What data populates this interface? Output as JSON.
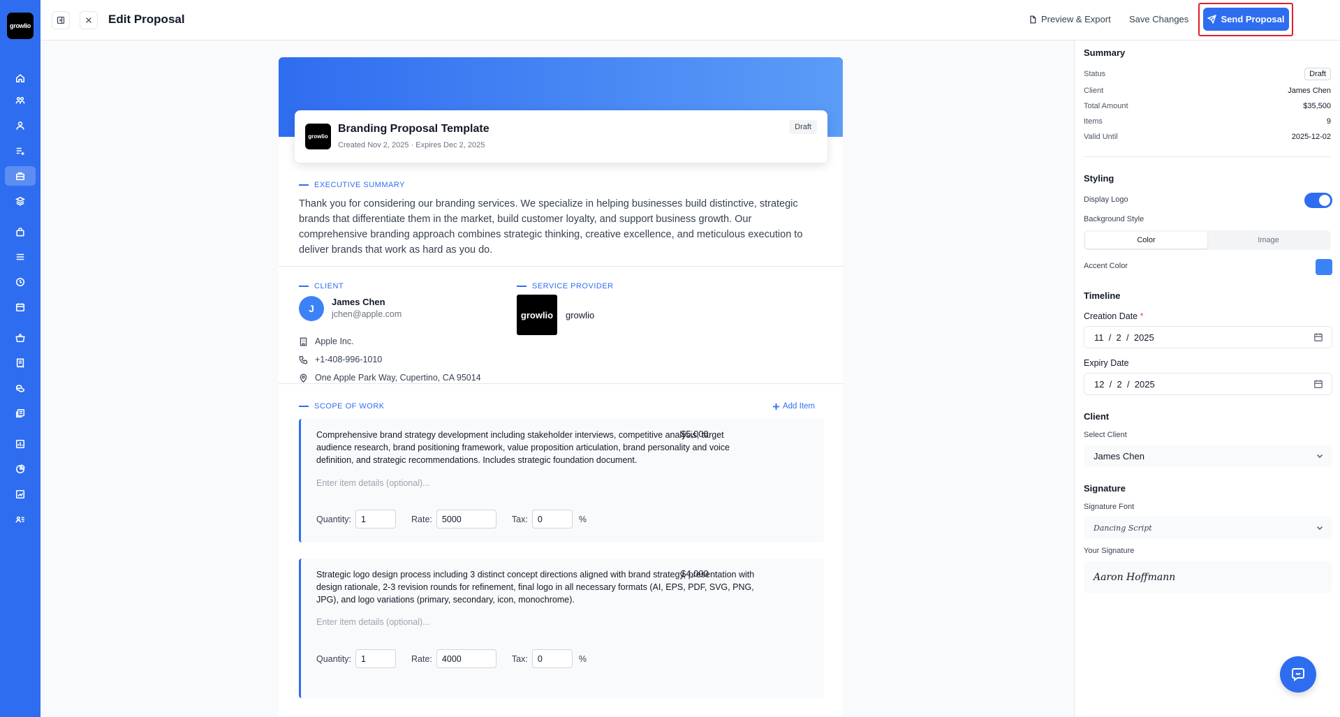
{
  "brand": {
    "logo_text": "growlio",
    "accent": "#2f6df0"
  },
  "sidebar": {
    "items": [
      {
        "icon": "home-icon"
      },
      {
        "icon": "team-icon"
      },
      {
        "icon": "user-icon"
      },
      {
        "icon": "list-add-icon"
      },
      {
        "icon": "briefcase-icon",
        "active": true
      },
      {
        "icon": "layers-icon"
      },
      {
        "icon": "bag-icon"
      },
      {
        "icon": "menu-icon"
      },
      {
        "icon": "clock-icon"
      },
      {
        "icon": "calendar-icon"
      },
      {
        "icon": "basket-icon"
      },
      {
        "icon": "receipt-icon"
      },
      {
        "icon": "coins-icon"
      },
      {
        "icon": "documents-icon"
      },
      {
        "icon": "chart-icon"
      },
      {
        "icon": "pie-icon"
      },
      {
        "icon": "report-icon"
      },
      {
        "icon": "contacts-icon"
      }
    ]
  },
  "header": {
    "title": "Edit Proposal",
    "preview_label": "Preview & Export",
    "save_label": "Save Changes",
    "send_label": "Send Proposal"
  },
  "proposal": {
    "logo_text": "growlio",
    "title": "Branding Proposal Template",
    "meta": "Created Nov 2, 2025 · Expires Dec 2, 2025",
    "status": "Draft",
    "exec_label": "EXECUTIVE SUMMARY",
    "exec_text": "Thank you for considering our branding services. We specialize in helping businesses build distinctive, strategic brands that differentiate them in the market, build customer loyalty, and support business growth. Our comprehensive branding approach combines strategic thinking, creative excellence, and meticulous execution to deliver brands that work as hard as you do.",
    "client_label": "CLIENT",
    "client": {
      "initial": "J",
      "name": "James Chen",
      "email": "jchen@apple.com",
      "company": "Apple Inc.",
      "phone": "+1-408-996-1010",
      "address": "One Apple Park Way, Cupertino, CA 95014"
    },
    "provider_label": "SERVICE PROVIDER",
    "provider": {
      "logo_text": "growlio",
      "name": "growlio"
    },
    "scope_label": "SCOPE OF WORK",
    "add_item_label": "Add Item",
    "field_labels": {
      "quantity": "Quantity:",
      "rate": "Rate:",
      "tax": "Tax:",
      "percent": "%"
    },
    "detail_placeholder": "Enter item details (optional)...",
    "items": [
      {
        "description": "Comprehensive brand strategy development including stakeholder interviews, competitive analysis, target audience research, brand positioning framework, value proposition articulation, brand personality and voice definition, and strategic recommendations. Includes strategic foundation document.",
        "price": "$5,000",
        "quantity": "1",
        "rate": "5000",
        "tax": "0"
      },
      {
        "description": "Strategic logo design process including 3 distinct concept directions aligned with brand strategy, presentation with design rationale, 2-3 revision rounds for refinement, final logo in all necessary formats (AI, EPS, PDF, SVG, PNG, JPG), and logo variations (primary, secondary, icon, monochrome).",
        "price": "$4,000",
        "quantity": "1",
        "rate": "4000",
        "tax": "0"
      }
    ]
  },
  "panel": {
    "summary_heading": "Summary",
    "summary": [
      {
        "label": "Status",
        "value": "Draft"
      },
      {
        "label": "Client",
        "value": "James Chen"
      },
      {
        "label": "Total Amount",
        "value": "$35,500"
      },
      {
        "label": "Items",
        "value": "9"
      },
      {
        "label": "Valid Until",
        "value": "2025-12-02"
      }
    ],
    "styling_heading": "Styling",
    "display_logo_label": "Display Logo",
    "display_logo_on": true,
    "bg_style_label": "Background Style",
    "bg_options": [
      "Color",
      "Image"
    ],
    "bg_selected": "Color",
    "accent_label": "Accent Color",
    "accent_color": "#3b82f6",
    "timeline_heading": "Timeline",
    "creation_label": "Creation Date",
    "required_mark": "*",
    "creation_value": "11  /  2  /  2025",
    "expiry_label": "Expiry Date",
    "expiry_value": "12  /  2  /  2025",
    "client_heading": "Client",
    "select_client_label": "Select Client",
    "select_client_value": "James Chen",
    "signature_heading": "Signature",
    "sig_font_label": "Signature Font",
    "sig_font_value": "Dancing Script",
    "your_sig_label": "Your Signature",
    "signature_value": "Aaron Hoffmann"
  }
}
